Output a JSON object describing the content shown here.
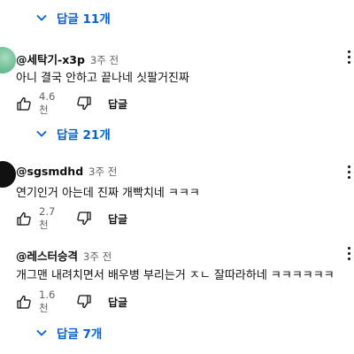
{
  "reply_toggles": [
    {
      "label": "답글 11개"
    },
    {
      "label": "답글 21개"
    },
    {
      "label": "답글 7개"
    }
  ],
  "comments": [
    {
      "author": "@세탁기-x3p",
      "time": "3주 전",
      "text": "아니 결국 안하고 끝나네 싯팔거진짜",
      "likes": "4.6천",
      "reply_label": "답글",
      "avatar_color": "#6cbf95"
    },
    {
      "author": "@sgsmdhd",
      "time": "3주 전",
      "text": "연기인거 아는데 진짜 개빡치네 ㅋㅋㅋ",
      "likes": "2.7천",
      "reply_label": "답글",
      "avatar_color": "#111111"
    },
    {
      "author": "@레스터승격",
      "time": "3주 전",
      "text": "개그맨 내려치면서 배우병 부리는거 ㅈㄴ 잘따라하네 ㅋㅋㅋㅋㅋㅋ",
      "likes": "1.6천",
      "reply_label": "답글"
    }
  ],
  "colors": {
    "accent": "#065fd4",
    "secondary_text": "#606060"
  },
  "icons": [
    "chevron-down-icon",
    "thumbs-up-icon",
    "thumbs-down-icon",
    "more-vert-icon"
  ]
}
